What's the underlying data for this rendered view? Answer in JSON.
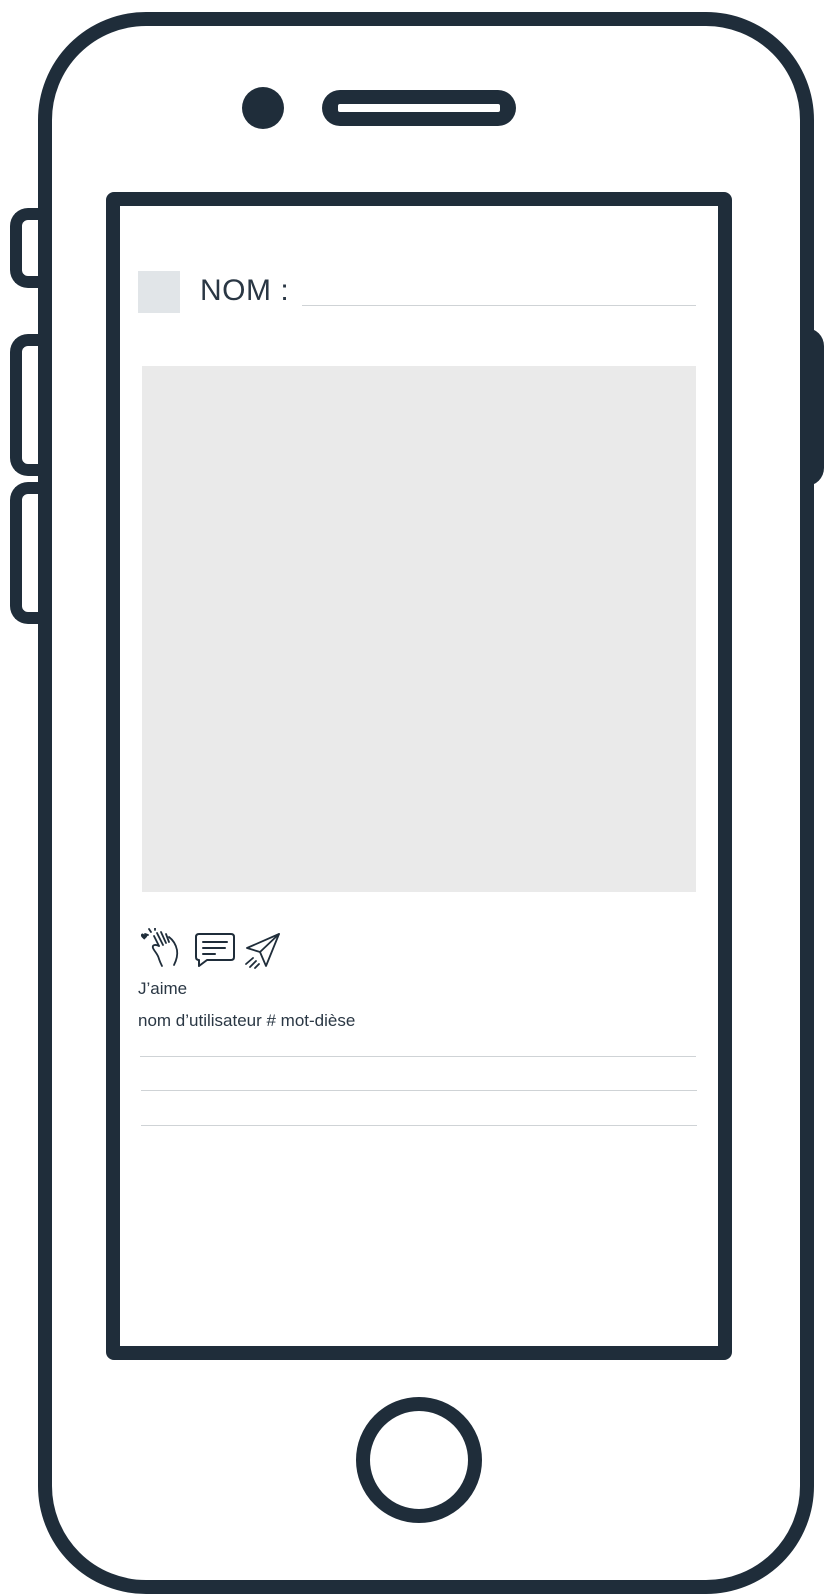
{
  "post": {
    "name_label": "NOM :",
    "likes_label": "J’aime",
    "caption": "nom d’utilisateur # mot-dièse"
  },
  "icons": {
    "like": "heart-hand-icon",
    "comment": "speech-bubble-icon",
    "share": "paper-plane-icon"
  },
  "colors": {
    "frame": "#1f2d3a",
    "photo_placeholder": "#eaeaea",
    "avatar_placeholder": "#e1e5e8",
    "rule": "#cfd3d6"
  }
}
